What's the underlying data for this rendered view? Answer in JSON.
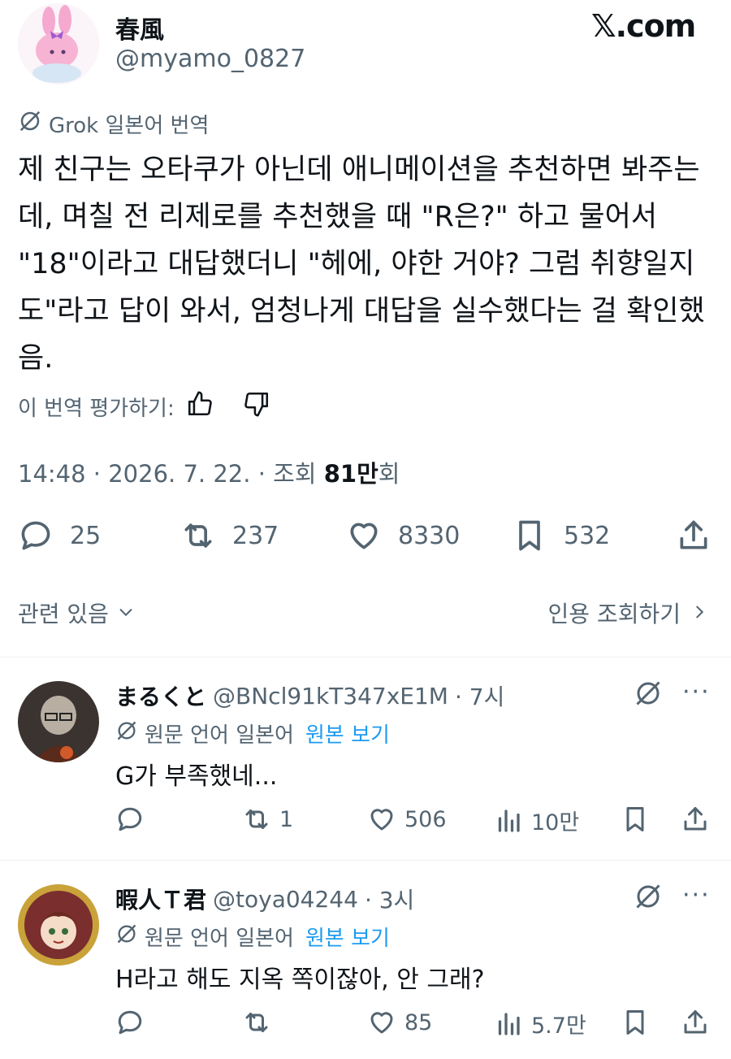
{
  "author": {
    "name": "春風",
    "handle": "@myamo_0827"
  },
  "brand": "𝕏.com",
  "translation": {
    "label": "Grok 일본어 번역",
    "rate_label": "이 번역 평가하기:"
  },
  "tweet": {
    "text": "제 친구는 오타쿠가 아닌데 애니메이션을 추천하면 봐주는데, 며칠 전 리제로를 추천했을 때 \"R은?\" 하고 물어서 \"18\"이라고 대답했더니 \"헤에, 야한 거야? 그럼 취향일지도\"라고 답이 와서, 엄청나게 대답을 실수했다는 걸 확인했음.",
    "time": "14:48 · 2026. 7. 22. · 조회 ",
    "views_number": "81만",
    "views_suffix": "회"
  },
  "stats": {
    "replies": "25",
    "retweets": "237",
    "likes": "8330",
    "bookmarks": "532"
  },
  "related_label": "관련 있음",
  "quotes_label": "인용 조회하기",
  "replies": [
    {
      "name": "まるくと",
      "handle": "@BNcl91kT347xE1M",
      "time": "· 7시",
      "lang_label": "원문 언어 일본어",
      "view_original": "원본 보기",
      "text": "G가 부족했네...",
      "retweets": "1",
      "likes": "506",
      "views": "10만"
    },
    {
      "name": "暇人Ｔ君",
      "handle": "@toya04244",
      "time": "· 3시",
      "lang_label": "원문 언어 일본어",
      "view_original": "원본 보기",
      "text": "H라고 해도 지옥 쪽이잖아, 안 그래?",
      "retweets": "",
      "likes": "85",
      "views": "5.7만"
    }
  ]
}
